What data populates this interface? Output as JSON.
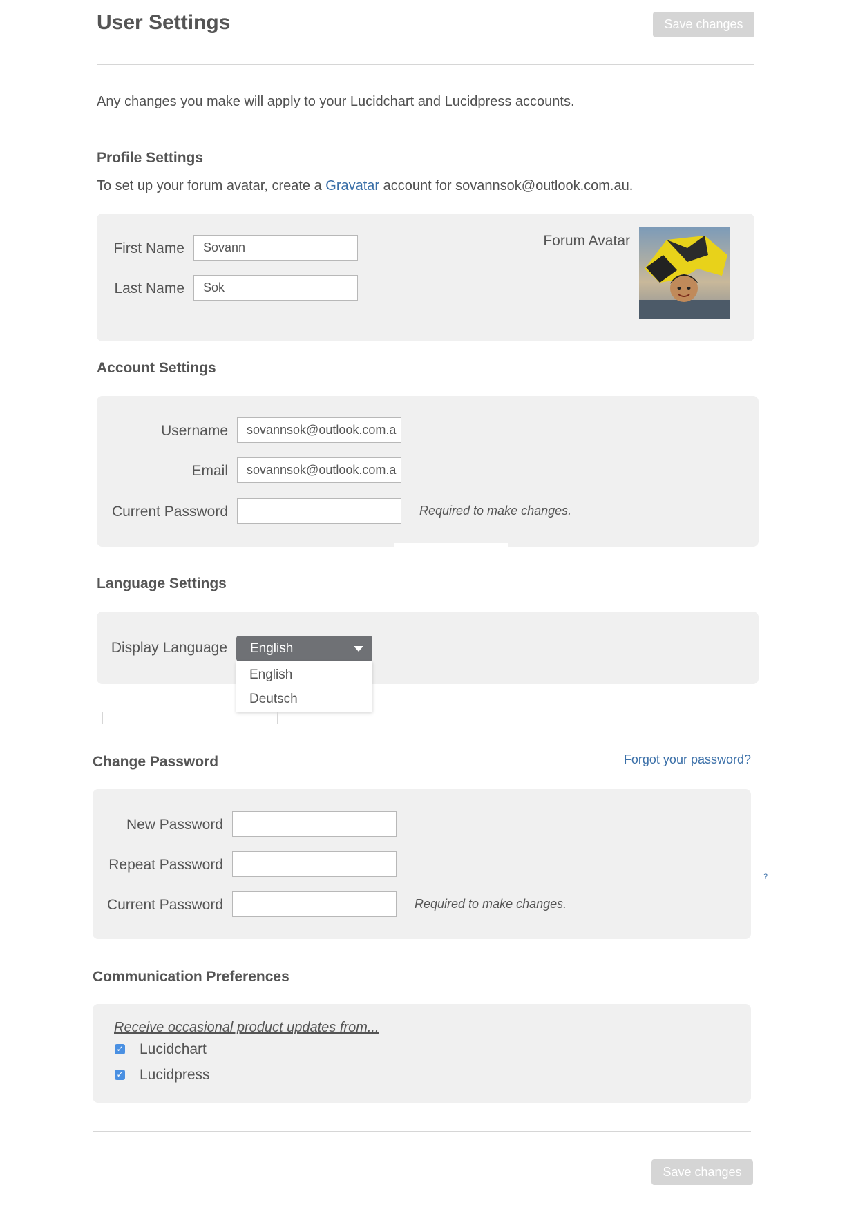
{
  "header": {
    "title": "User Settings",
    "save_label": "Save changes"
  },
  "intro": "Any changes you make will apply to your Lucidchart and Lucidpress accounts.",
  "profile": {
    "title": "Profile Settings",
    "desc_prefix": "To set up your forum avatar, create a ",
    "desc_link": "Gravatar",
    "desc_suffix": " account for sovannsok@outlook.com.au.",
    "first_name_label": "First Name",
    "first_name_value": "Sovann",
    "last_name_label": "Last Name",
    "last_name_value": "Sok",
    "avatar_label": "Forum Avatar"
  },
  "account": {
    "title": "Account Settings",
    "username_label": "Username",
    "username_value": "sovannsok@outlook.com.a",
    "email_label": "Email",
    "email_value": "sovannsok@outlook.com.a",
    "current_password_label": "Current Password",
    "hint": "Required to make changes."
  },
  "language": {
    "title": "Language Settings",
    "label": "Display Language",
    "selected": "English",
    "options": [
      "English",
      "Deutsch"
    ]
  },
  "password": {
    "title": "Change Password",
    "forgot_link": "Forgot your password?",
    "new_label": "New Password",
    "repeat_label": "Repeat Password",
    "current_label": "Current Password",
    "hint": "Required to make changes.",
    "help_mark": "?"
  },
  "communication": {
    "title": "Communication Preferences",
    "subtitle": "Receive occasional product updates from...",
    "options": [
      {
        "label": "Lucidchart",
        "checked": true
      },
      {
        "label": "Lucidpress",
        "checked": true
      }
    ]
  },
  "footer": {
    "save_label": "Save changes"
  },
  "colors": {
    "link": "#3a6fa8",
    "panel": "#f0f0f0",
    "checkbox": "#4a90e2",
    "select": "#6f7175"
  }
}
